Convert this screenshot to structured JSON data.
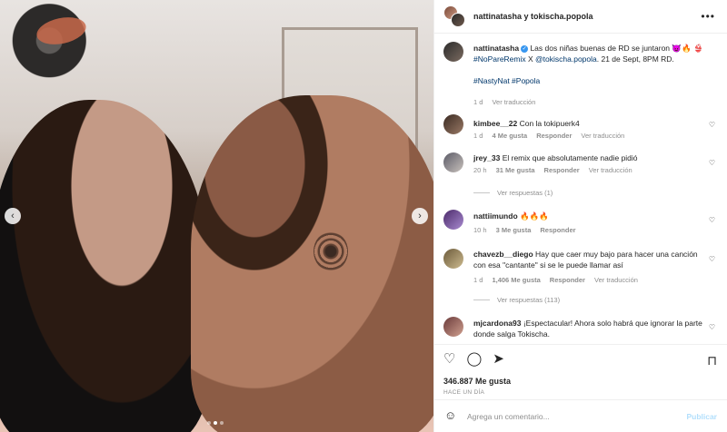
{
  "header": {
    "title": "nattinatasha y tokischa.popola"
  },
  "caption": {
    "username": "nattinatasha",
    "text_1": "Las dos niñas buenas de RD se juntaron 😈🔥",
    "text_2": "👙",
    "hashtag": "#NoPareRemix",
    "text_3": " X ",
    "mention": "@tokischa.popola",
    "text_4": ". 21 de Sept, 8PM RD.",
    "tags": "#NastyNat #Popola",
    "time": "1 d",
    "translate": "Ver traducción"
  },
  "comments": [
    {
      "username": "kimbee__22",
      "text": "Con la tokipuerk4",
      "time": "1 d",
      "likes": "4 Me gusta",
      "reply": "Responder",
      "translate": "Ver traducción"
    },
    {
      "username": "jrey_33",
      "text": "El remix que absolutamente nadie pidió",
      "time": "20 h",
      "likes": "31 Me gusta",
      "reply": "Responder",
      "translate": "Ver traducción",
      "view_replies": "Ver respuestas (1)"
    },
    {
      "username": "nattiimundo",
      "text": "🔥🔥🔥",
      "time": "10 h",
      "likes": "3 Me gusta",
      "reply": "Responder"
    },
    {
      "username": "chavezb__diego",
      "text": "Hay que caer muy bajo para hacer una canción con esa \"cantante\" si se le puede llamar así",
      "time": "1 d",
      "likes": "1,406 Me gusta",
      "reply": "Responder",
      "translate": "Ver traducción",
      "view_replies": "Ver respuestas (113)"
    },
    {
      "username": "mjcardona93",
      "text": "¡Espectacular! Ahora solo habrá que ignorar la parte donde salga Tokischa."
    }
  ],
  "actions": {
    "likes": "346.887 Me gusta",
    "ago": "HACE UN DÍA"
  },
  "composer": {
    "placeholder": "Agrega un comentario...",
    "post": "Publicar"
  },
  "icons": {
    "more": "more-options-icon",
    "like": "heart-icon",
    "comment": "comment-icon",
    "share": "send-icon",
    "save": "bookmark-icon",
    "emoji": "smiley-icon",
    "prev": "chevron-left-icon",
    "next": "chevron-right-icon"
  },
  "colors": {
    "link": "#00376b",
    "muted": "#8e8e8e",
    "verified": "#3897f0",
    "post_disabled": "#b2dffc"
  }
}
